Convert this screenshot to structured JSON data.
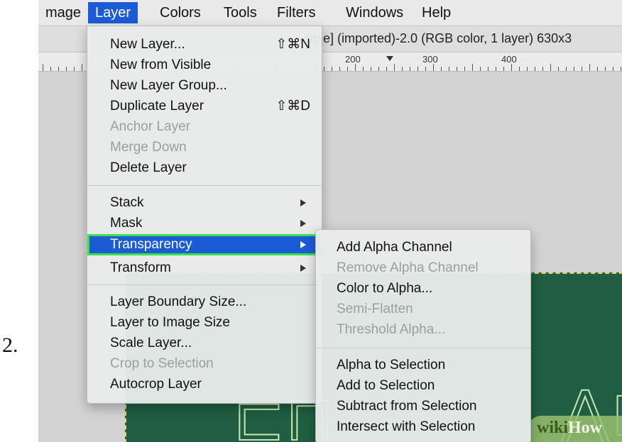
{
  "step_number": "2.",
  "menubar": {
    "items": [
      {
        "label": "mage"
      },
      {
        "label": "Layer"
      },
      {
        "label": "Colors"
      },
      {
        "label": "Tools"
      },
      {
        "label": "Filters"
      },
      {
        "label": "Windows"
      },
      {
        "label": "Help"
      }
    ]
  },
  "window_title": "nple] (imported)-2.0 (RGB color, 1 layer) 630x3",
  "ruler": {
    "labels": [
      "200",
      "300",
      "400"
    ]
  },
  "layer_menu": {
    "items": [
      {
        "label": "New Layer...",
        "shortcut": "⇧⌘N"
      },
      {
        "label": "New from Visible"
      },
      {
        "label": "New Layer Group..."
      },
      {
        "label": "Duplicate Layer",
        "shortcut": "⇧⌘D"
      },
      {
        "label": "Anchor Layer"
      },
      {
        "label": "Merge Down"
      },
      {
        "label": "Delete Layer"
      },
      {
        "label": "Stack"
      },
      {
        "label": "Mask"
      },
      {
        "label": "Transparency"
      },
      {
        "label": "Transform"
      },
      {
        "label": "Layer Boundary Size..."
      },
      {
        "label": "Layer to Image Size"
      },
      {
        "label": "Scale Layer..."
      },
      {
        "label": "Crop to Selection"
      },
      {
        "label": "Autocrop Layer"
      }
    ]
  },
  "transparency_menu": {
    "items": [
      {
        "label": "Add Alpha Channel"
      },
      {
        "label": "Remove Alpha Channel"
      },
      {
        "label": "Color to Alpha..."
      },
      {
        "label": "Semi-Flatten"
      },
      {
        "label": "Threshold Alpha..."
      },
      {
        "label": "Alpha to Selection"
      },
      {
        "label": "Add to Selection"
      },
      {
        "label": "Subtract from Selection"
      },
      {
        "label": "Intersect with Selection"
      }
    ]
  },
  "watermark": {
    "part1": "wiki",
    "part2": "How"
  },
  "colors": {
    "menu_highlight": "#1c5bd6",
    "highlight_outline": "#39e04a",
    "image_green": "#1f5e42"
  }
}
